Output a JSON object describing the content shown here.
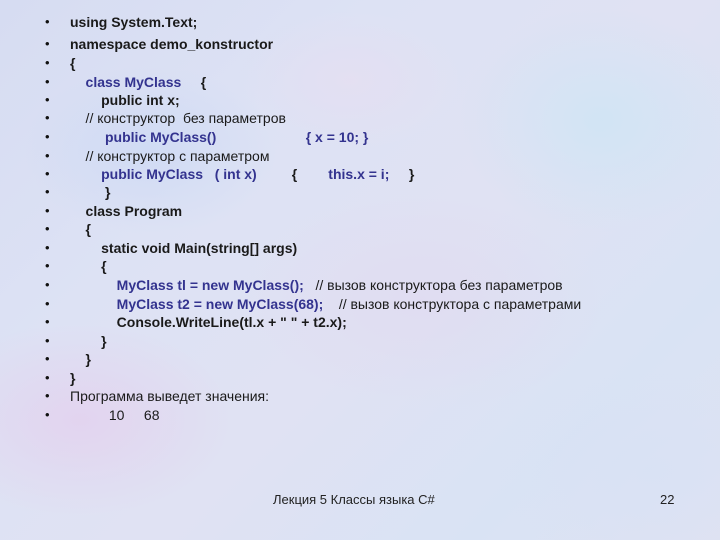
{
  "slide": {
    "lines": [
      {
        "segments": [
          {
            "text": "using System.Text;",
            "style": "bold"
          }
        ]
      },
      {
        "segments": [
          {
            "text": "namespace demo_konstructor",
            "style": "bold"
          }
        ]
      },
      {
        "segments": [
          {
            "text": "{",
            "style": "bold"
          }
        ]
      },
      {
        "segments": [
          {
            "text": "    class MyClass",
            "style": "blue"
          },
          {
            "text": "     {",
            "style": "bold"
          }
        ]
      },
      {
        "segments": [
          {
            "text": "        public int x;",
            "style": "bold"
          }
        ]
      },
      {
        "segments": [
          {
            "text": "    // конструктор  без параметров",
            "style": "normal"
          }
        ]
      },
      {
        "segments": [
          {
            "text": "         public MyClass()",
            "style": "blue"
          },
          {
            "text": "                       { x = 10; }",
            "style": "blue"
          }
        ]
      },
      {
        "segments": [
          {
            "text": "    // конструктор с параметром",
            "style": "normal"
          }
        ]
      },
      {
        "segments": [
          {
            "text": "        public MyClass   ( int x)",
            "style": "blue"
          },
          {
            "text": "         {",
            "style": "bold"
          },
          {
            "text": "        this.x = i;",
            "style": "blue"
          },
          {
            "text": "     }",
            "style": "bold"
          }
        ]
      },
      {
        "segments": [
          {
            "text": "         }",
            "style": "bold"
          }
        ]
      },
      {
        "segments": [
          {
            "text": "    class Program",
            "style": "bold"
          }
        ]
      },
      {
        "segments": [
          {
            "text": "    {",
            "style": "bold"
          }
        ]
      },
      {
        "segments": [
          {
            "text": "        static void Main(string[] args)",
            "style": "bold"
          }
        ]
      },
      {
        "segments": [
          {
            "text": "        {",
            "style": "bold"
          }
        ]
      },
      {
        "segments": [
          {
            "text": "            MyClass tl = new MyClass();",
            "style": "blue"
          },
          {
            "text": "   // вызов конструктора без параметров",
            "style": "normal"
          }
        ]
      },
      {
        "segments": [
          {
            "text": "            MyClass t2 = new MyClass(68);",
            "style": "blue"
          },
          {
            "text": "    // вызов конструктора с параметрами",
            "style": "normal"
          }
        ]
      },
      {
        "segments": [
          {
            "text": "            Console.WriteLine(tl.x + \" \" + t2.x);",
            "style": "bold"
          }
        ]
      },
      {
        "segments": [
          {
            "text": "        }",
            "style": "bold"
          }
        ]
      },
      {
        "segments": [
          {
            "text": "    }",
            "style": "bold"
          }
        ]
      },
      {
        "segments": [
          {
            "text": "}",
            "style": "bold"
          }
        ]
      },
      {
        "segments": [
          {
            "text": "Программа выведет значения:",
            "style": "normal"
          }
        ]
      },
      {
        "segments": [
          {
            "text": "          10     68",
            "style": "normal"
          }
        ]
      }
    ],
    "bullet_char": "•",
    "colors": {
      "keyword_blue": "#33338f",
      "text": "#1a1a1a"
    }
  },
  "footer": {
    "title": "Лекция 5 Классы языка C#",
    "page_number": "22"
  }
}
